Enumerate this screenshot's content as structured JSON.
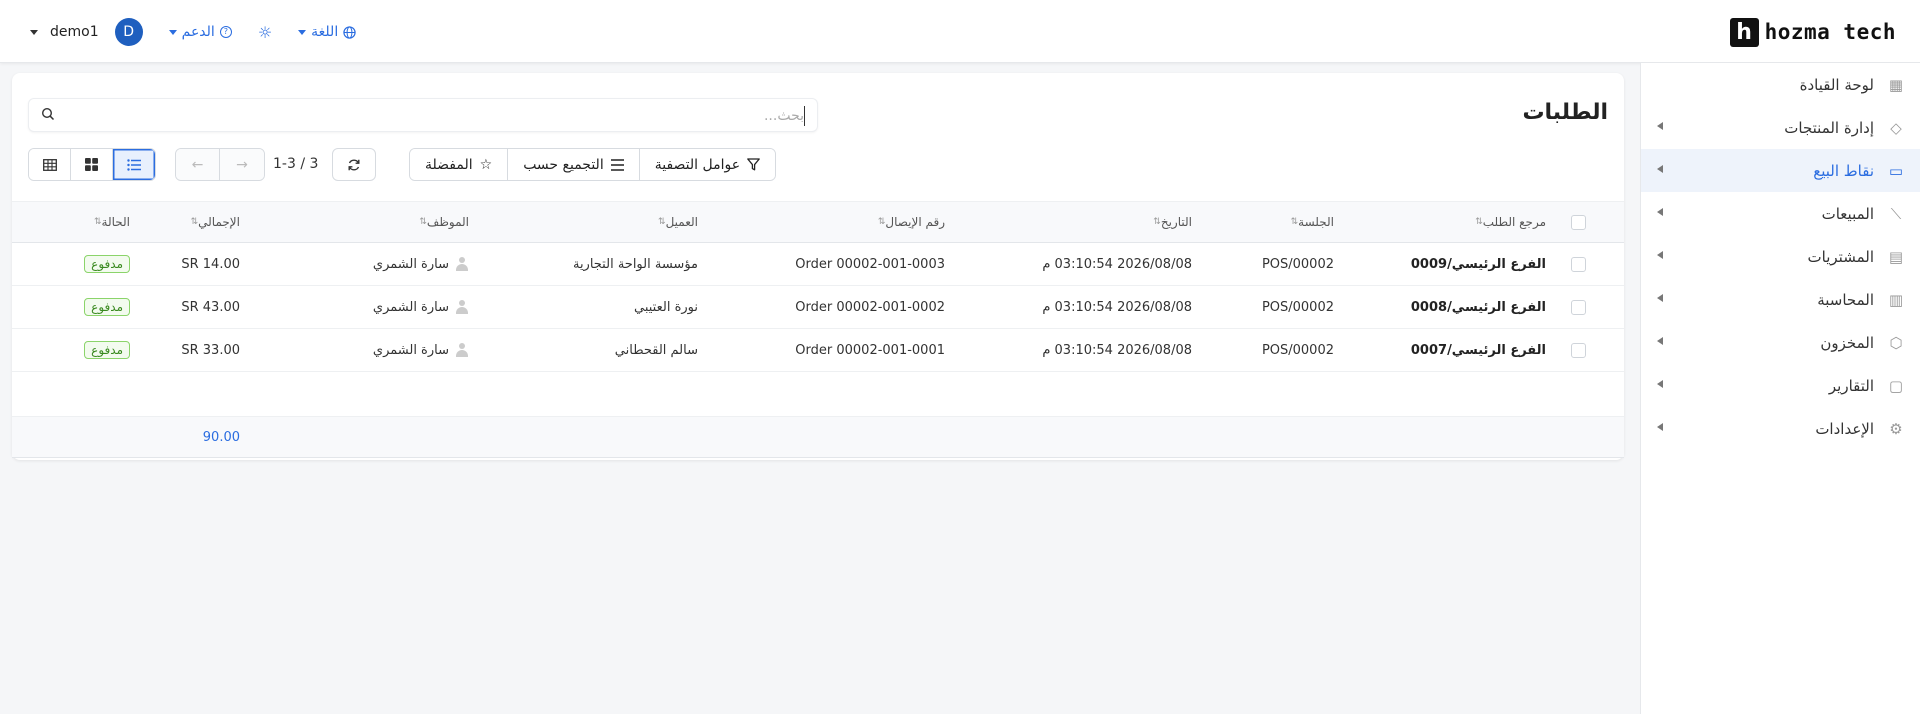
{
  "brand": {
    "logo_letter": "h",
    "name": "hozma tech"
  },
  "topbar": {
    "user_name": "demo1",
    "avatar_letter": "D",
    "support_label": "الدعم",
    "language_label": "اللغة"
  },
  "sidebar": {
    "items": [
      {
        "label": "لوحة القيادة",
        "icon": "dashboard-icon",
        "active": false,
        "has_arrow": false
      },
      {
        "label": "إدارة المنتجات",
        "icon": "tag-icon",
        "active": false,
        "has_arrow": true
      },
      {
        "label": "نقاط البيع",
        "icon": "store-icon",
        "active": true,
        "has_arrow": true
      },
      {
        "label": "المبيعات",
        "icon": "chart-line-icon",
        "active": false,
        "has_arrow": true
      },
      {
        "label": "المشتريات",
        "icon": "wallet-icon",
        "active": false,
        "has_arrow": true
      },
      {
        "label": "المحاسبة",
        "icon": "ledger-icon",
        "active": false,
        "has_arrow": true
      },
      {
        "label": "المخزون",
        "icon": "box-icon",
        "active": false,
        "has_arrow": true
      },
      {
        "label": "التقارير",
        "icon": "report-icon",
        "active": false,
        "has_arrow": true
      },
      {
        "label": "الإعدادات",
        "icon": "gear-icon",
        "active": false,
        "has_arrow": true
      }
    ]
  },
  "page": {
    "title": "الطلبات",
    "search_placeholder": "بحث...",
    "filters_label": "عوامل التصفية",
    "group_by_label": "التجميع حسب",
    "favorites_label": "المفضلة",
    "pager_text": "1-3 / 3"
  },
  "table": {
    "headers": {
      "ref": "مرجع الطلب",
      "session": "الجلسة",
      "date": "التاريخ",
      "receipt": "رقم الإيصال",
      "client": "العميل",
      "employee": "الموظف",
      "total": "الإجمالي",
      "status": "الحالة"
    },
    "rows": [
      {
        "ref": "الفرع الرئيسي/0009",
        "session": "POS/00002",
        "date": "2026/08/08 03:10:54 م",
        "receipt": "Order 00002-001-0003",
        "client": "مؤسسة الواحة التجارية",
        "employee": "سارة الشمري",
        "total": "SR 14.00",
        "status": "مدفوع"
      },
      {
        "ref": "الفرع الرئيسي/0008",
        "session": "POS/00002",
        "date": "2026/08/08 03:10:54 م",
        "receipt": "Order 00002-001-0002",
        "client": "نورة العتيبي",
        "employee": "سارة الشمري",
        "total": "SR 43.00",
        "status": "مدفوع"
      },
      {
        "ref": "الفرع الرئيسي/0007",
        "session": "POS/00002",
        "date": "2026/08/08 03:10:54 م",
        "receipt": "Order 00002-001-0001",
        "client": "سالم القحطاني",
        "employee": "سارة الشمري",
        "total": "SR 33.00",
        "status": "مدفوع"
      }
    ],
    "footer_total": "90.00"
  },
  "colors": {
    "accent": "#2b6de0",
    "paid_badge": "#3a8a20",
    "avatar": "#1f5fbf"
  }
}
